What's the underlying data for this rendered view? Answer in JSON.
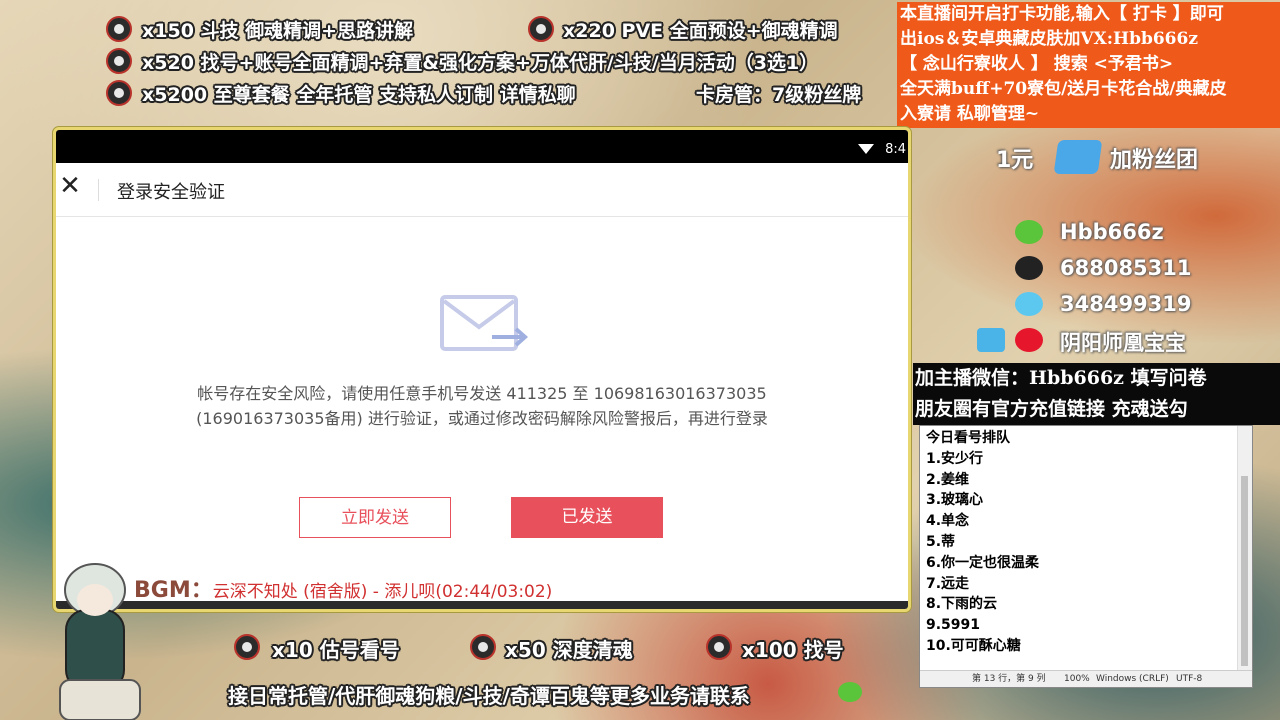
{
  "top_promos": [
    {
      "text": "x150 斗技 御魂精调+思路讲解"
    },
    {
      "text": "x220 PVE 全面预设+御魂精调"
    },
    {
      "text": "x520 找号+账号全面精调+弃置&强化方案+万体代肝/斗技/当月活动（3选1）"
    },
    {
      "text": "x5200 至尊套餐 全年托管 支持私人订制 详情私聊"
    },
    {
      "text": "卡房管：7级粉丝牌"
    }
  ],
  "notice": {
    "lines": [
      "本直播间开启打卡功能,输入【 打卡 】即可",
      "出ios＆安卓典藏皮肤加VX:Hbb666z",
      "【 念山行寮收人 】 搜索 <予君书>",
      "全天满buff+70寮包/送月卡花合战/典藏皮",
      "入寮请 私聊管理~"
    ]
  },
  "fan_club": {
    "price": "1元",
    "label": "加粉丝团"
  },
  "contacts": [
    {
      "icon": "wechat-icon",
      "text": "Hbb666z"
    },
    {
      "icon": "qq-icon",
      "text": "688085311"
    },
    {
      "icon": "qq-group-icon",
      "text": "348499319"
    },
    {
      "icon": "weibo-icon",
      "text": "阴阳师凰宝宝"
    }
  ],
  "black_banner": {
    "line1": "加主播微信：Hbb666z 填写问卷",
    "line2": "朋友圈有官方充值链接 充魂送勾"
  },
  "notepad": {
    "heading": "今日看号排队",
    "items": [
      "1.安少行",
      "2.姜维",
      "3.玻璃心",
      "4.单念",
      "5.蒂",
      "6.你一定也很温柔",
      "7.远走",
      "8.下雨的云",
      "9.5991",
      "10.可可酥心糖"
    ],
    "status": {
      "position": "第 13 行，第 9 列",
      "zoom": "100%",
      "eol": "Windows (CRLF)",
      "encoding": "UTF-8"
    }
  },
  "phone": {
    "clock": "8:4",
    "title": "登录安全验证",
    "message_line1": "帐号存在安全风险，请使用任意手机号发送 411325 至 10698163016373035",
    "message_line2": "(169016373035备用) 进行验证，或通过修改密码解除风险警报后，再进行登录",
    "send_now": "立即发送",
    "sent": "已发送"
  },
  "bgm": {
    "label": "BGM：",
    "song": "云深不知处 (宿舍版) - 添儿呗(02:44/03:02)"
  },
  "bottom_promos": [
    {
      "text": "x10 估号看号"
    },
    {
      "text": "x50 深度清魂"
    },
    {
      "text": "x100 找号"
    },
    {
      "text": "接日常托管/代肝御魂狗粮/斗技/奇谭百鬼等更多业务请联系"
    }
  ],
  "colors": {
    "accent": "#e8505b",
    "notice_bg": "#ef5a1b"
  }
}
